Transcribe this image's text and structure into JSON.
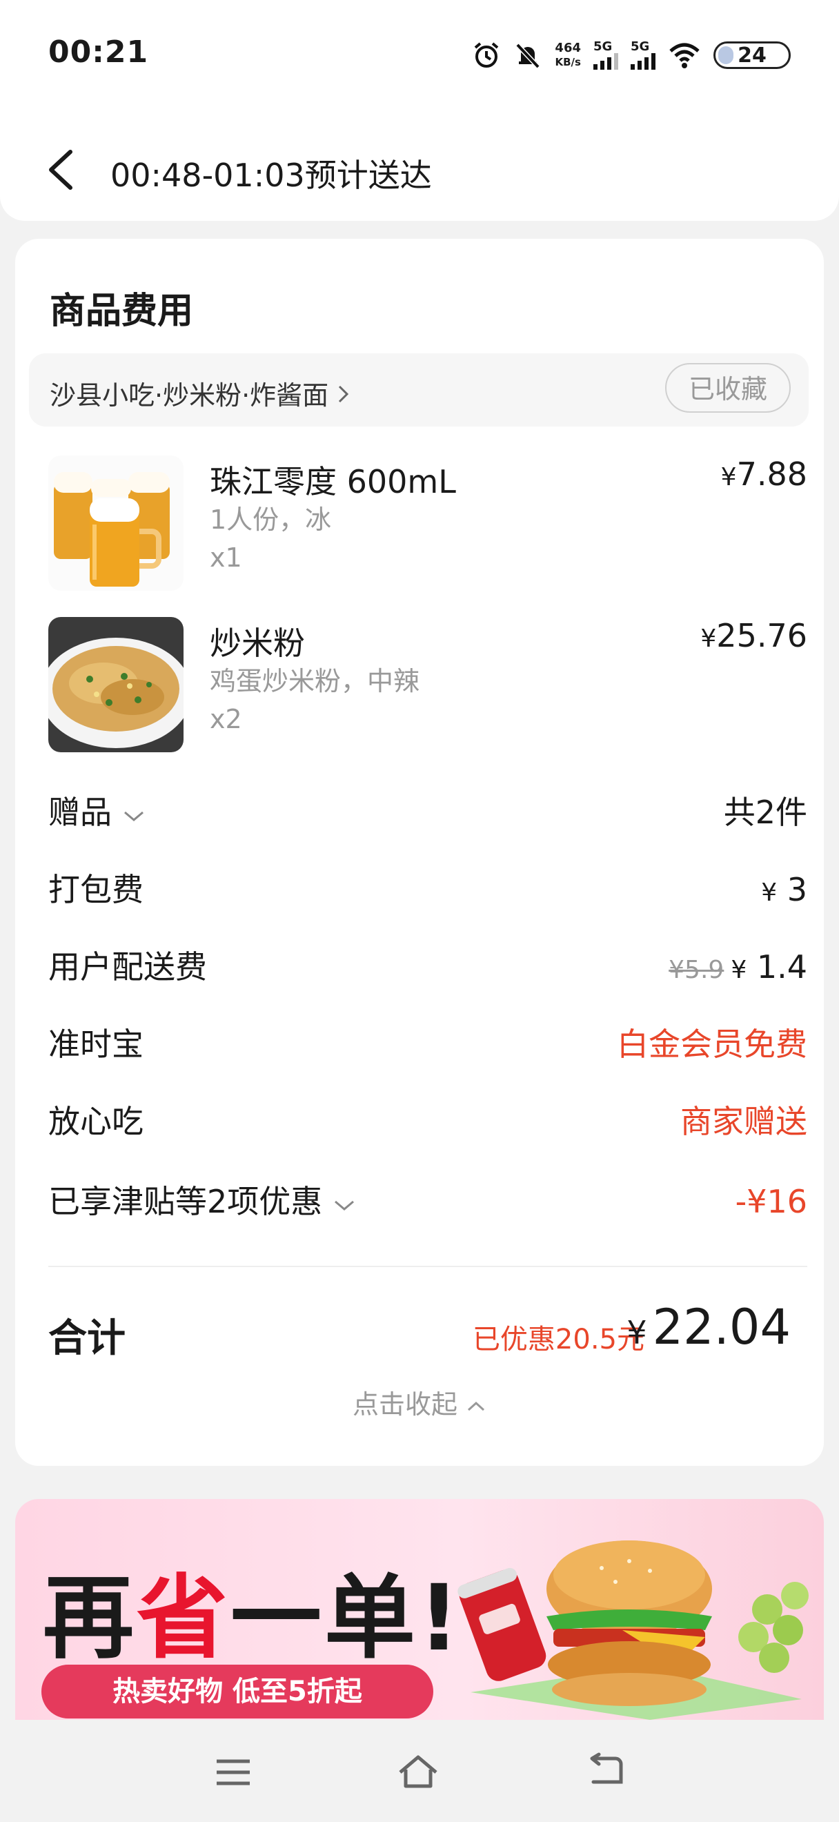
{
  "status_bar": {
    "time": "00:21",
    "net_speed_value": "464",
    "net_speed_unit": "KB/s",
    "sim1": "5G",
    "sim2": "5G",
    "battery": "24"
  },
  "header": {
    "title": "00:48-01:03预计送达"
  },
  "card": {
    "title": "商品费用",
    "shop_name": "沙县小吃·炒米粉·炸酱面",
    "favorite_label": "已收藏",
    "items": [
      {
        "name": "珠江零度 600mL",
        "spec": "1人份，冰",
        "qty": "x1",
        "price": "7.88",
        "currency": "¥",
        "image_icon": "beer-mugs"
      },
      {
        "name": "炒米粉",
        "spec": "鸡蛋炒米粉，中辣",
        "qty": "x2",
        "price": "25.76",
        "currency": "¥",
        "image_icon": "fried-rice-noodles"
      }
    ],
    "fees": {
      "gift_label": "赠品",
      "gift_value": "共2件",
      "packing_label": "打包费",
      "packing_value": "3",
      "delivery_label": "用户配送费",
      "delivery_original": "¥5.9",
      "delivery_value": "1.4",
      "ontime_label": "准时宝",
      "ontime_value": "白金会员免费",
      "safe_label": "放心吃",
      "safe_value": "商家赠送",
      "discount_label": "已享津贴等2项优惠",
      "discount_value": "-¥16"
    },
    "total_label": "合计",
    "saved_text": "已优惠20.5元",
    "currency": "¥",
    "total_value": "22.04",
    "collapse_label": "点击收起"
  },
  "banner": {
    "slogan_part1": "再",
    "slogan_highlight": "省",
    "slogan_part2": "一单!",
    "subtitle": "热卖好物 低至5折起"
  },
  "colors": {
    "accent_red": "#e8462a",
    "muted_gray": "#999999",
    "banner_pink": "#ffd6e4"
  }
}
